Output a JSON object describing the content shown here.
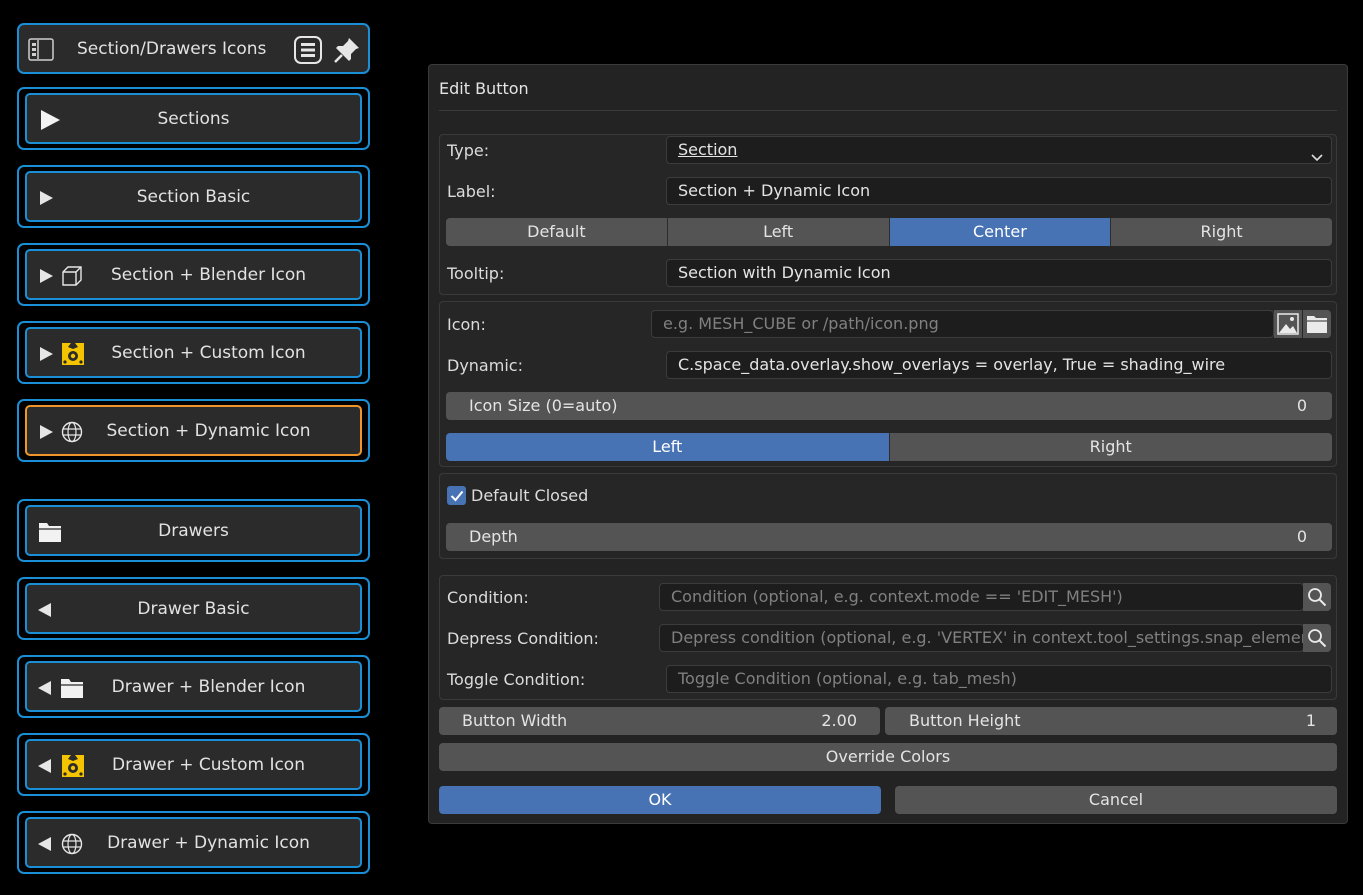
{
  "left_panel": {
    "header": {
      "title": "Section/Drawers Icons"
    },
    "sections": [
      {
        "label": "Sections",
        "arrow": "play-icon",
        "icon": ""
      },
      {
        "label": "Section Basic",
        "arrow": "play-icon",
        "icon": ""
      },
      {
        "label": "Section + Blender Icon",
        "arrow": "play-icon",
        "icon": "cube-icon"
      },
      {
        "label": "Section + Custom Icon",
        "arrow": "play-icon",
        "icon": "custom-yellow-icon"
      },
      {
        "label": "Section + Dynamic Icon",
        "arrow": "play-icon",
        "icon": "globe-icon",
        "active": true
      }
    ],
    "drawers": [
      {
        "label": "Drawers",
        "icon": "folder-icon"
      },
      {
        "label": "Drawer Basic",
        "arrow": "triangle-left-icon"
      },
      {
        "label": "Drawer + Blender Icon",
        "arrow": "triangle-left-icon",
        "icon": "folder-icon"
      },
      {
        "label": "Drawer + Custom Icon",
        "arrow": "triangle-left-icon",
        "icon": "custom-yellow-icon"
      },
      {
        "label": "Drawer + Dynamic Icon",
        "arrow": "triangle-left-icon",
        "icon": "globe-icon"
      }
    ]
  },
  "dialog": {
    "title": "Edit Button",
    "type_label": "Type:",
    "type_value": "Section",
    "label_label": "Label:",
    "label_value": "Section + Dynamic Icon",
    "align_options": [
      "Default",
      "Left",
      "Center",
      "Right"
    ],
    "align_selected": "Center",
    "tooltip_label": "Tooltip:",
    "tooltip_value": "Section with Dynamic Icon",
    "icon_label": "Icon:",
    "icon_placeholder": "e.g. MESH_CUBE or /path/icon.png",
    "dynamic_label": "Dynamic:",
    "dynamic_value": "C.space_data.overlay.show_overlays = overlay, True = shading_wire",
    "icon_size_label": "Icon Size (0=auto)",
    "icon_size_value": "0",
    "icon_side_options": [
      "Left",
      "Right"
    ],
    "icon_side_selected": "Left",
    "default_closed_label": "Default Closed",
    "default_closed": true,
    "depth_label": "Depth",
    "depth_value": "0",
    "condition_label": "Condition:",
    "condition_placeholder": "Condition (optional, e.g. context.mode == 'EDIT_MESH')",
    "depress_label": "Depress Condition:",
    "depress_placeholder": "Depress condition (optional, e.g. 'VERTEX' in context.tool_settings.snap_elements)",
    "toggle_label": "Toggle Condition:",
    "toggle_placeholder": "Toggle Condition (optional, e.g. tab_mesh)",
    "button_width_label": "Button Width",
    "button_width_value": "2.00",
    "button_height_label": "Button Height",
    "button_height_value": "1",
    "override_colors_label": "Override Colors",
    "ok_label": "OK",
    "cancel_label": "Cancel"
  },
  "colors": {
    "accent_blue": "#4772b3",
    "frame_blue": "#1a8fd6",
    "active_orange": "#f0952a",
    "custom_icon_yellow": "#f5c400"
  }
}
